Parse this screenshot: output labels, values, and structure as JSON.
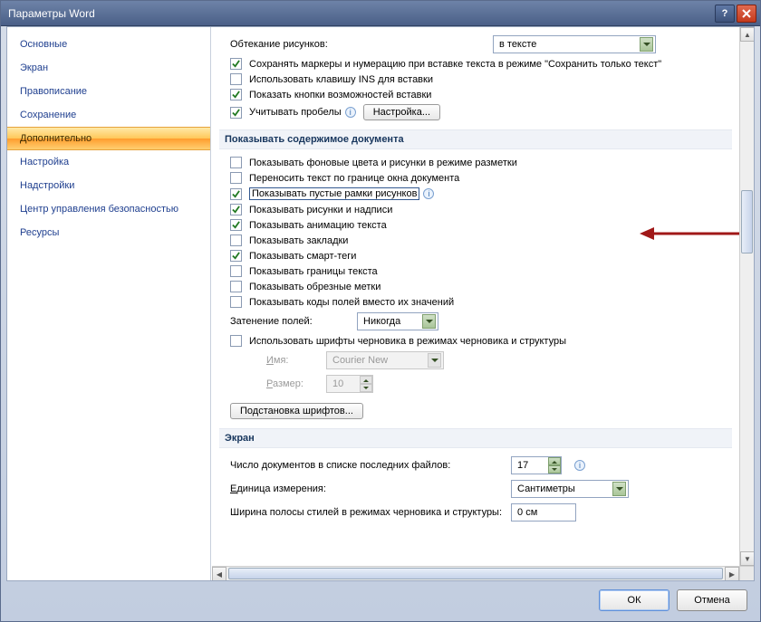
{
  "window": {
    "title": "Параметры Word"
  },
  "sidebar": {
    "items": [
      {
        "label": "Основные"
      },
      {
        "label": "Экран"
      },
      {
        "label": "Правописание"
      },
      {
        "label": "Сохранение"
      },
      {
        "label": "Дополнительно",
        "selected": true
      },
      {
        "label": "Настройка"
      },
      {
        "label": "Надстройки"
      },
      {
        "label": "Центр управления безопасностью"
      },
      {
        "label": "Ресурсы"
      }
    ]
  },
  "top": {
    "wrap_label": "Обтекание рисунков:",
    "wrap_value": "в тексте",
    "opt_keep_bullets": "Сохранять маркеры и нумерацию при вставке текста в режиме \"Сохранить только текст\"",
    "opt_ins_key": "Использовать клавишу INS для вставки",
    "opt_paste_buttons": "Показать кнопки возможностей вставки",
    "opt_spaces": "Учитывать пробелы",
    "settings_btn": "Настройка..."
  },
  "section_doc": {
    "title": "Показывать содержимое документа",
    "opts": [
      {
        "label": "Показывать фоновые цвета и рисунки в режиме разметки",
        "checked": false,
        "accel": "ф"
      },
      {
        "label": "Переносить текст по границе окна документа",
        "checked": false,
        "accel": "г"
      },
      {
        "label": "Показывать пустые рамки рисунков",
        "checked": true,
        "accel": "п",
        "highlight": true
      },
      {
        "label": "Показывать рисунки и надписи",
        "checked": true,
        "accel": "р"
      },
      {
        "label": "Показывать анимацию текста",
        "checked": true,
        "accel": "а"
      },
      {
        "label": "Показывать закладки",
        "checked": false,
        "accel": "з"
      },
      {
        "label": "Показывать смарт-теги",
        "checked": true,
        "accel": "с"
      },
      {
        "label": "Показывать границы текста",
        "checked": false
      },
      {
        "label": "Показывать обрезные метки",
        "checked": false
      },
      {
        "label": "Показывать коды полей вместо их значений",
        "checked": false,
        "accel": "к"
      }
    ],
    "shading_label": "Затенение полей:",
    "shading_value": "Никогда",
    "draft_font": "Использовать шрифты черновика в режимах черновика и структуры",
    "font_name_label": "Имя:",
    "font_name_value": "Courier New",
    "font_size_label": "Размер:",
    "font_size_value": "10",
    "font_sub_btn": "Подстановка шрифтов..."
  },
  "section_screen": {
    "title": "Экран",
    "recent_label": "Число документов в списке последних файлов:",
    "recent_value": "17",
    "units_label": "Единица измерения:",
    "units_value": "Сантиметры",
    "stylewidth_label": "Ширина полосы стилей в режимах черновика и структуры:",
    "stylewidth_value": "0 см"
  },
  "footer": {
    "ok": "ОК",
    "cancel": "Отмена"
  },
  "u": {
    "wrap_accel": "р",
    "spaces_accel": "б",
    "settings_accel": "Н",
    "name_accel": "И",
    "size_accel": "Р",
    "sub_accel": "П",
    "units_accel": "Е"
  }
}
